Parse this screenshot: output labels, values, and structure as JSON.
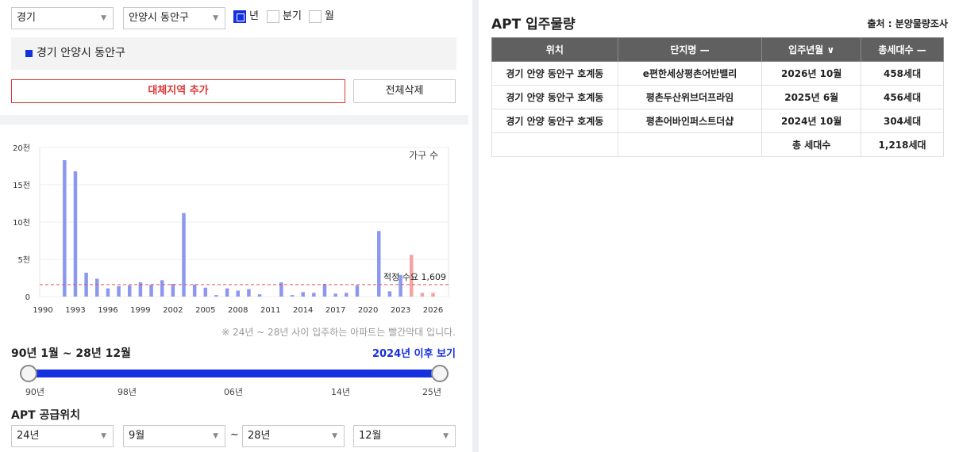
{
  "filters": {
    "region_select": "경기",
    "district_select": "안양시 동안구",
    "period_options": [
      {
        "label": "년",
        "checked": true
      },
      {
        "label": "분기",
        "checked": false
      },
      {
        "label": "월",
        "checked": false
      }
    ]
  },
  "selected_region": "경기 안양시 동안구",
  "buttons": {
    "add_region": "대체지역 추가",
    "clear_all": "전체삭제"
  },
  "chart_data": {
    "type": "bar",
    "legend_text": "가구 수",
    "y_ticks": [
      "0",
      "5천",
      "10천",
      "15천",
      "20천"
    ],
    "ylim": [
      0,
      20000
    ],
    "x_tick_labels": [
      "1990",
      "1993",
      "1996",
      "1999",
      "2002",
      "2005",
      "2008",
      "2011",
      "2014",
      "2017",
      "2020",
      "2023",
      "2026"
    ],
    "categories": [
      1990,
      1991,
      1992,
      1993,
      1994,
      1995,
      1996,
      1997,
      1998,
      1999,
      2000,
      2001,
      2002,
      2003,
      2004,
      2005,
      2006,
      2007,
      2008,
      2009,
      2010,
      2011,
      2012,
      2013,
      2014,
      2015,
      2016,
      2017,
      2018,
      2019,
      2020,
      2021,
      2022,
      2023,
      2024,
      2025,
      2026
    ],
    "values": [
      0,
      0,
      18300,
      16800,
      3200,
      2400,
      1100,
      1400,
      1500,
      1900,
      1600,
      2200,
      1700,
      11200,
      1600,
      1200,
      200,
      1100,
      800,
      1000,
      300,
      0,
      1900,
      200,
      600,
      500,
      1700,
      400,
      500,
      1500,
      0,
      8800,
      700,
      2900,
      5600,
      500,
      500
    ],
    "future_from": 2024,
    "colors": {
      "past": "#8c98f0",
      "future": "#f4a3a3",
      "reference": "#e05555"
    },
    "reference_value": 1609,
    "reference_label": "적정 수요 1,609"
  },
  "chart_note": "※ 24년 ~ 28년 사이 입주하는 아파트는 빨간막대 입니다.",
  "range": {
    "title": "90년 1월 ~ 28년 12월",
    "link": "2024년 이후 보기",
    "ticks": [
      "90년",
      "98년",
      "06년",
      "14년",
      "25년"
    ]
  },
  "supply": {
    "title": "APT 공급위치",
    "from_year": "24년",
    "from_month": "9월",
    "tilde": "~",
    "to_year": "28년",
    "to_month": "12월"
  },
  "right": {
    "title": "APT 입주물량",
    "source": "출처 : 분양물량조사",
    "columns": [
      "위치",
      "단지명 —",
      "입주년월 ∨",
      "총세대수 —"
    ],
    "rows": [
      [
        "경기 안양 동안구 호계동",
        "e편한세상평촌어반밸리",
        "2026년 10월",
        "458세대"
      ],
      [
        "경기 안양 동안구 호계동",
        "평촌두산위브더프라임",
        "2025년 6월",
        "456세대"
      ],
      [
        "경기 안양 동안구 호계동",
        "평촌어바인퍼스트더샵",
        "2024년 10월",
        "304세대"
      ]
    ],
    "total_label": "총 세대수",
    "total_value": "1,218세대"
  }
}
